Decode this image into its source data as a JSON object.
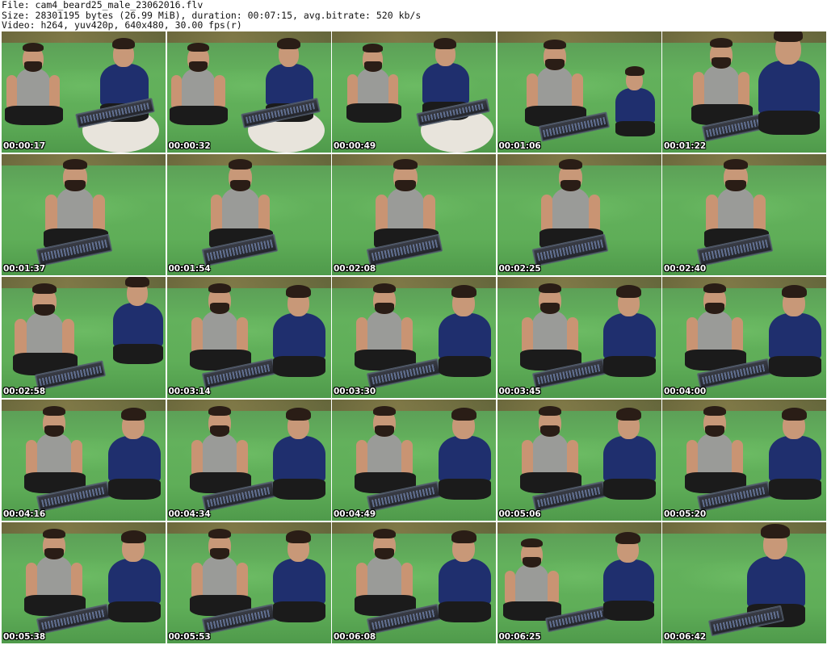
{
  "header": {
    "file": "File: cam4_beard25_male_23062016.flv",
    "size": "Size: 28301195 bytes (26.99 MiB), duration: 00:07:15, avg.bitrate: 520 kb/s",
    "video": "Video: h264, yuv420p, 640x480, 30.00 fps(r)"
  },
  "thumbnails": [
    {
      "timestamp": "00:00:17",
      "scene": "two-seated-wide"
    },
    {
      "timestamp": "00:00:32",
      "scene": "two-seated-wide"
    },
    {
      "timestamp": "00:00:49",
      "scene": "two-reclined"
    },
    {
      "timestamp": "00:01:06",
      "scene": "one-keyboard-other-leaning"
    },
    {
      "timestamp": "00:01:22",
      "scene": "one-keyboard-other-close"
    },
    {
      "timestamp": "00:01:37",
      "scene": "one-keyboard"
    },
    {
      "timestamp": "00:01:54",
      "scene": "one-keyboard"
    },
    {
      "timestamp": "00:02:08",
      "scene": "one-keyboard"
    },
    {
      "timestamp": "00:02:25",
      "scene": "one-keyboard"
    },
    {
      "timestamp": "00:02:40",
      "scene": "one-keyboard"
    },
    {
      "timestamp": "00:02:58",
      "scene": "one-keyboard-other-bent"
    },
    {
      "timestamp": "00:03:14",
      "scene": "two-keyboard"
    },
    {
      "timestamp": "00:03:30",
      "scene": "two-keyboard"
    },
    {
      "timestamp": "00:03:45",
      "scene": "two-keyboard"
    },
    {
      "timestamp": "00:04:00",
      "scene": "two-keyboard"
    },
    {
      "timestamp": "00:04:16",
      "scene": "two-keyboard"
    },
    {
      "timestamp": "00:04:34",
      "scene": "two-keyboard"
    },
    {
      "timestamp": "00:04:49",
      "scene": "two-keyboard"
    },
    {
      "timestamp": "00:05:06",
      "scene": "two-keyboard"
    },
    {
      "timestamp": "00:05:20",
      "scene": "two-keyboard"
    },
    {
      "timestamp": "00:05:38",
      "scene": "two-keyboard"
    },
    {
      "timestamp": "00:05:53",
      "scene": "two-keyboard"
    },
    {
      "timestamp": "00:06:08",
      "scene": "two-keyboard"
    },
    {
      "timestamp": "00:06:25",
      "scene": "one-blurred-two"
    },
    {
      "timestamp": "00:06:42",
      "scene": "other-keyboard"
    }
  ],
  "colors": {
    "couch_green": "#5fae58",
    "tank_top_gray": "#9a9b98",
    "tshirt_navy": "#1f2f6e",
    "timestamp_text": "#ffffff"
  }
}
